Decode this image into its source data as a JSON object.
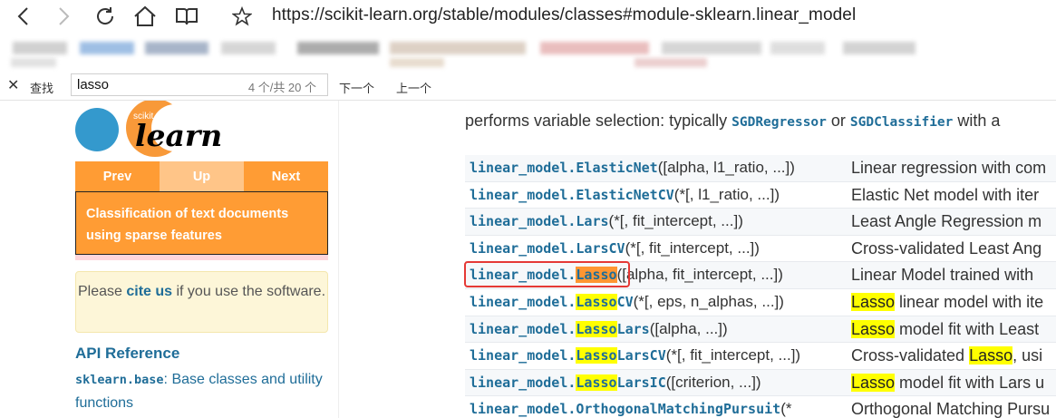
{
  "browser": {
    "url": "https://scikit-learn.org/stable/modules/classes#module-sklearn.linear_model",
    "icons": [
      "back-icon",
      "forward-icon",
      "refresh-icon",
      "home-icon",
      "reading-view-icon",
      "favorite-star-icon"
    ]
  },
  "findbar": {
    "close": "✕",
    "label": "查找",
    "query": "lasso",
    "count": "4 个/共 20 个",
    "next": "下一个",
    "prev": "上一个"
  },
  "sidebar": {
    "logo_small": "scikit",
    "logo_big": "learn",
    "nav": {
      "prev": "Prev",
      "up": "Up",
      "next": "Next"
    },
    "nav_link": "Classification of text documents using sparse features",
    "cite": {
      "before": "Please ",
      "link": "cite us",
      "after": " if you use the software."
    },
    "api_heading": "API Reference",
    "api_item": {
      "code": "sklearn.base",
      "text": ": Base classes and utility functions"
    }
  },
  "main": {
    "intro": {
      "before": "performs variable selection: typically ",
      "code1": "SGDRegressor",
      "middle": " or ",
      "code2": "SGDClassifier",
      "after": " with a"
    },
    "rows": [
      {
        "prefix": "linear_model.",
        "hl": "",
        "rest": "ElasticNet",
        "args": "([alpha, l1_ratio, ...])",
        "desc_hl": "",
        "desc": "Linear regression with com"
      },
      {
        "prefix": "linear_model.",
        "hl": "",
        "rest": "ElasticNetCV",
        "args": "(*[, l1_ratio, ...])",
        "desc_hl": "",
        "desc": "Elastic Net model with iter"
      },
      {
        "prefix": "linear_model.",
        "hl": "",
        "rest": "Lars",
        "args": "(*[, fit_intercept, ...])",
        "desc_hl": "",
        "desc": "Least Angle Regression m"
      },
      {
        "prefix": "linear_model.",
        "hl": "",
        "rest": "LarsCV",
        "args": "(*[, fit_intercept, ...])",
        "desc_hl": "",
        "desc": "Cross-validated Least Ang"
      },
      {
        "prefix": "linear_model.",
        "hl": "Lasso",
        "rest": "",
        "args": "([alpha, fit_intercept, ...])",
        "desc_hl": "",
        "desc": "Linear Model trained with"
      },
      {
        "prefix": "linear_model.",
        "hl": "Lasso",
        "rest": "CV",
        "args": "(*[, eps, n_alphas, ...])",
        "desc_hl": "Lasso",
        "desc": " linear model with ite"
      },
      {
        "prefix": "linear_model.",
        "hl": "Lasso",
        "rest": "Lars",
        "args": "([alpha, ...])",
        "desc_hl": "Lasso",
        "desc": " model fit with Least"
      },
      {
        "prefix": "linear_model.",
        "hl": "Lasso",
        "rest": "LarsCV",
        "args": "(*[, fit_intercept, ...])",
        "desc_pre": "Cross-validated ",
        "desc_hl": "Lasso",
        "desc": ", usi"
      },
      {
        "prefix": "linear_model.",
        "hl": "Lasso",
        "rest": "LarsIC",
        "args": "([criterion, ...])",
        "desc_hl": "Lasso",
        "desc": " model fit with Lars u"
      },
      {
        "prefix": "linear_model.",
        "hl": "",
        "rest": "OrthogonalMatchingPursuit",
        "args": "(*",
        "desc_hl": "",
        "desc": "Orthogonal Matching Pursu"
      }
    ]
  }
}
